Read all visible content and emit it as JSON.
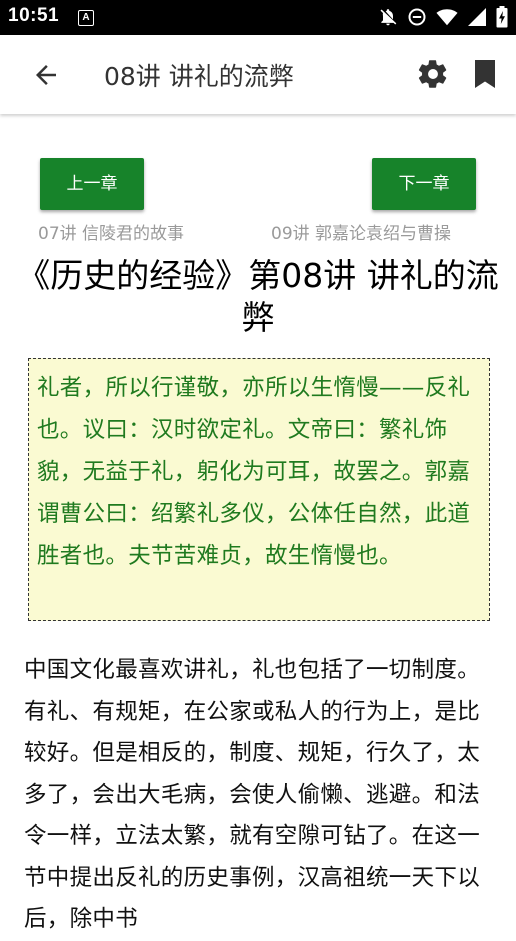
{
  "status_bar": {
    "time": "10:51",
    "notification_badge": "A"
  },
  "header": {
    "title": "08讲 讲礼的流弊"
  },
  "navigation": {
    "prev_label": "上一章",
    "next_label": "下一章",
    "prev_chapter": "07讲 信陵君的故事",
    "next_chapter": "09讲 郭嘉论袁绍与曹操"
  },
  "chapter_title": "《历史的经验》第08讲 讲礼的流弊",
  "quote": "礼者，所以行谨敬，亦所以生惰慢——反礼也。议曰：汉时欲定礼。文帝曰：繁礼饰貌，无益于礼，躬化为可耳，故罢之。郭嘉谓曹公曰：绍繁礼多仪，公体任自然，此道胜者也。夫节苦难贞，故生惰慢也。",
  "body": "中国文化最喜欢讲礼，礼也包括了一切制度。有礼、有规矩，在公家或私人的行为上，是比较好。但是相反的，制度、规矩，行久了，太多了，会出大毛病，会使人偷懒、逃避。和法令一样，立法太繁，就有空隙可钻了。在这一节中提出反礼的历史事例，汉高祖统一天下以后，除中书",
  "colors": {
    "accent_green": "#17832a",
    "quote_text": "#1f7a1f",
    "quote_background": "#fafad2",
    "hint_gray": "#9a9a9a"
  },
  "icons": {
    "back": "arrow-back-icon",
    "settings": "gear-icon",
    "bookmark": "bookmark-icon"
  }
}
